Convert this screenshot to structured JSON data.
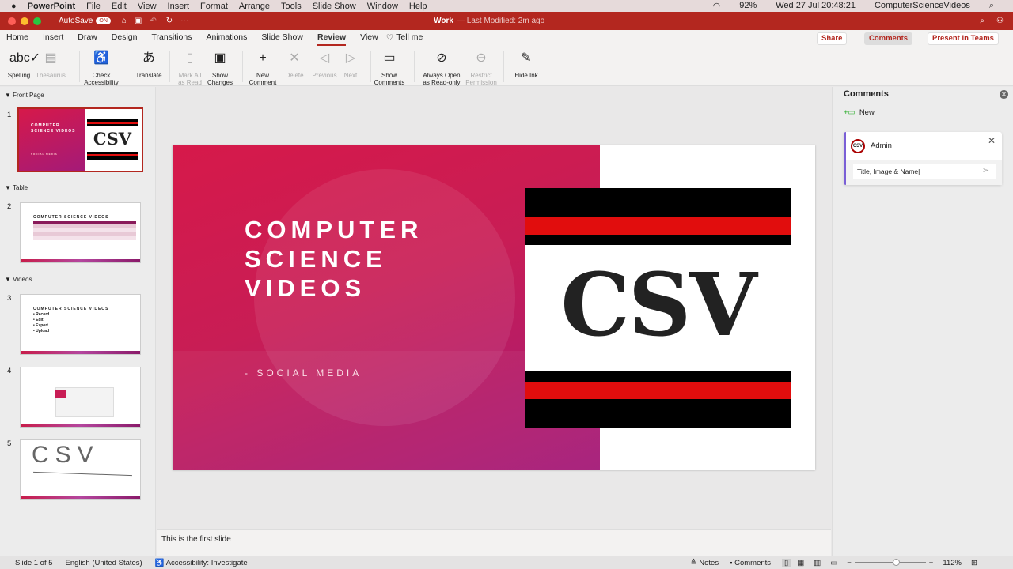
{
  "menubar": {
    "app": "PowerPoint",
    "items": [
      "File",
      "Edit",
      "View",
      "Insert",
      "Format",
      "Arrange",
      "Tools",
      "Slide Show",
      "Window",
      "Help"
    ],
    "battery": "92%",
    "datetime": "Wed 27 Jul  20:48:21",
    "user": "ComputerScienceVideos"
  },
  "titlebar": {
    "autosave": "AutoSave",
    "toggle": "ON",
    "doc": "Work",
    "modified": "— Last Modified: 2m ago"
  },
  "tabs": [
    "Home",
    "Insert",
    "Draw",
    "Design",
    "Transitions",
    "Animations",
    "Slide Show",
    "Review",
    "View",
    "Tell me"
  ],
  "top_buttons": {
    "share": "Share",
    "comments": "Comments",
    "teams": "Present in Teams"
  },
  "ribbon": [
    {
      "l1": "Spelling",
      "l2": "",
      "icon": "abc✓"
    },
    {
      "l1": "Thesaurus",
      "l2": "",
      "icon": "▤"
    },
    {
      "l1": "Check",
      "l2": "Accessibility",
      "icon": "♿"
    },
    {
      "l1": "Translate",
      "l2": "",
      "icon": "あ"
    },
    {
      "l1": "Mark All",
      "l2": "as Read",
      "icon": "▯"
    },
    {
      "l1": "Show",
      "l2": "Changes",
      "icon": "▣"
    },
    {
      "l1": "New",
      "l2": "Comment",
      "icon": "+"
    },
    {
      "l1": "Delete",
      "l2": "",
      "icon": "✕"
    },
    {
      "l1": "Previous",
      "l2": "",
      "icon": "◁"
    },
    {
      "l1": "Next",
      "l2": "",
      "icon": "▷"
    },
    {
      "l1": "Show",
      "l2": "Comments",
      "icon": "▭"
    },
    {
      "l1": "Always Open",
      "l2": "as Read-only",
      "icon": "⊘"
    },
    {
      "l1": "Restrict",
      "l2": "Permission",
      "icon": "⊖"
    },
    {
      "l1": "Hide Ink",
      "l2": "",
      "icon": "✎"
    }
  ],
  "sections": [
    "Front Page",
    "Table",
    "Videos"
  ],
  "thumbs": {
    "t1_title": "COMPUTER SCIENCE VIDEOS",
    "t1_sub": "SOCIAL MEDIA",
    "t2_title": "COMPUTER SCIENCE VIDEOS",
    "t3_title": "COMPUTER SCIENCE VIDEOS",
    "t3_bullets": [
      "• Record",
      "• Edit",
      "• Export",
      "• Upload"
    ],
    "t5_ink": "CSV",
    "nums": [
      "1",
      "2",
      "3",
      "4",
      "5"
    ]
  },
  "slide": {
    "title_lines": [
      "COMPUTER",
      "SCIENCE",
      "VIDEOS"
    ],
    "subtitle": "- SOCIAL MEDIA",
    "logo": "CSV"
  },
  "notes": "This is the first slide",
  "comments_pane": {
    "title": "Comments",
    "new": "New",
    "author": "Admin",
    "avatar": "CSV",
    "draft": "Title, Image & Name"
  },
  "status": {
    "slide": "Slide 1 of 5",
    "lang": "English (United States)",
    "access": "Accessibility: Investigate",
    "notes": "Notes",
    "comments": "Comments",
    "zoom": "112%"
  }
}
